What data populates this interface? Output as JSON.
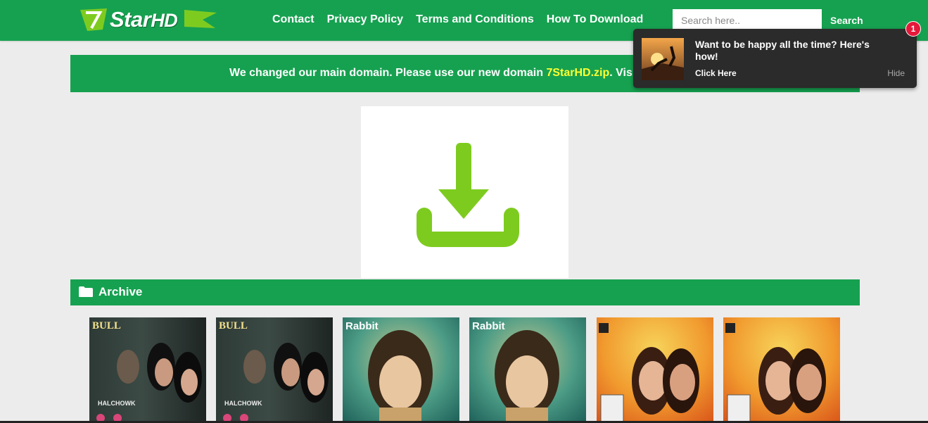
{
  "header": {
    "logo_text_star": "Star",
    "logo_text_hd": "HD",
    "nav": [
      "Contact",
      "Privacy Policy",
      "Terms and Conditions",
      "How To Download"
    ],
    "search_placeholder": "Search here..",
    "search_button": "Search"
  },
  "notice": {
    "text_before": "We changed our main domain. Please use our new domain ",
    "domain": "7StarHD.zip",
    "text_after": ". Visit and B"
  },
  "download_icon": "download-arrow-icon",
  "archive": {
    "title": "Archive",
    "thumbnails": [
      {
        "brand": "BULL",
        "caption": "HALCHOWK"
      },
      {
        "brand": "BULL",
        "caption": "HALCHOWK"
      },
      {
        "brand": "Rabbit"
      },
      {
        "brand": "Rabbit"
      },
      {
        "brand": ""
      },
      {
        "brand": ""
      }
    ]
  },
  "popup": {
    "title": "Want to be happy all the time? Here's how!",
    "cta": "Click Here",
    "hide": "Hide",
    "badge_count": "1"
  },
  "colors": {
    "brand_green": "#16a150",
    "download_green": "#7ecb20",
    "domain_yellow": "#ffff33",
    "badge_red": "#e6183a"
  }
}
